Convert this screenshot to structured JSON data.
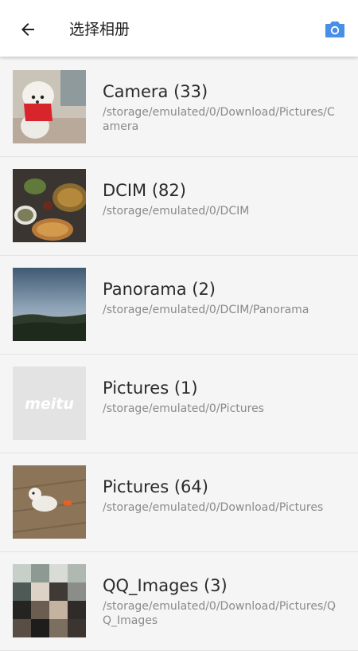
{
  "header": {
    "title": "选择相册",
    "back_icon": "arrow-left-icon",
    "camera_icon": "camera-icon",
    "accent_color": "#4a8fe7"
  },
  "albums": [
    {
      "name": "Camera (33)",
      "path": "/storage/emulated/0/Download/Pictures/Camera",
      "thumb": "poodle-photo"
    },
    {
      "name": "DCIM (82)",
      "path": "/storage/emulated/0/DCIM",
      "thumb": "food-photo"
    },
    {
      "name": "Panorama (2)",
      "path": "/storage/emulated/0/DCIM/Panorama",
      "thumb": "sky-photo"
    },
    {
      "name": "Pictures (1)",
      "path": "/storage/emulated/0/Pictures",
      "thumb": "meitu-logo"
    },
    {
      "name": "Pictures (64)",
      "path": "/storage/emulated/0/Download/Pictures",
      "thumb": "dog-floor-photo"
    },
    {
      "name": "QQ_Images (3)",
      "path": "/storage/emulated/0/Download/Pictures/QQ_Images",
      "thumb": "pixelated-photo"
    }
  ],
  "thumb_logo_text": "meitu"
}
